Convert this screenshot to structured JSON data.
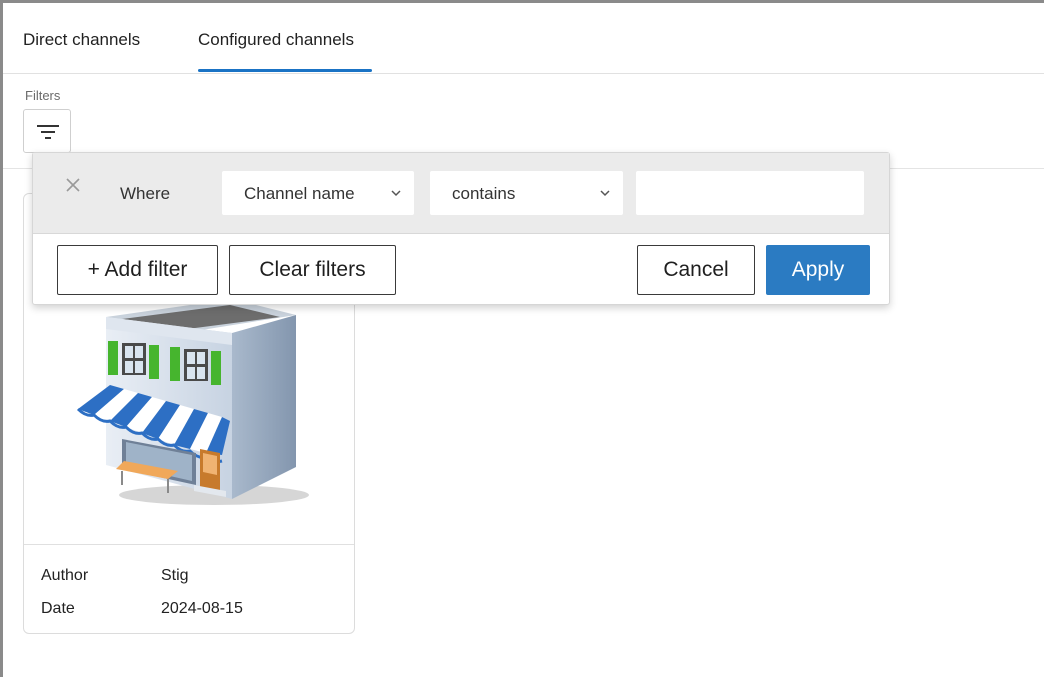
{
  "tabs": {
    "direct": "Direct channels",
    "configured": "Configured channels",
    "active": "configured"
  },
  "filters": {
    "label": "Filters"
  },
  "filter_popover": {
    "where_label": "Where",
    "field_value": "Channel name",
    "operator_value": "contains",
    "input_value": "",
    "add_filter_label": "+ Add filter",
    "clear_filters_label": "Clear filters",
    "cancel_label": "Cancel",
    "apply_label": "Apply"
  },
  "card": {
    "image_icon": "storefront-illustration",
    "author_label": "Author",
    "author_value": "Stig",
    "date_label": "Date",
    "date_value": "2024-08-15"
  },
  "colors": {
    "accent": "#1a73c5",
    "apply_button": "#2b7bc2",
    "filter_row_bg": "#ebebeb"
  }
}
